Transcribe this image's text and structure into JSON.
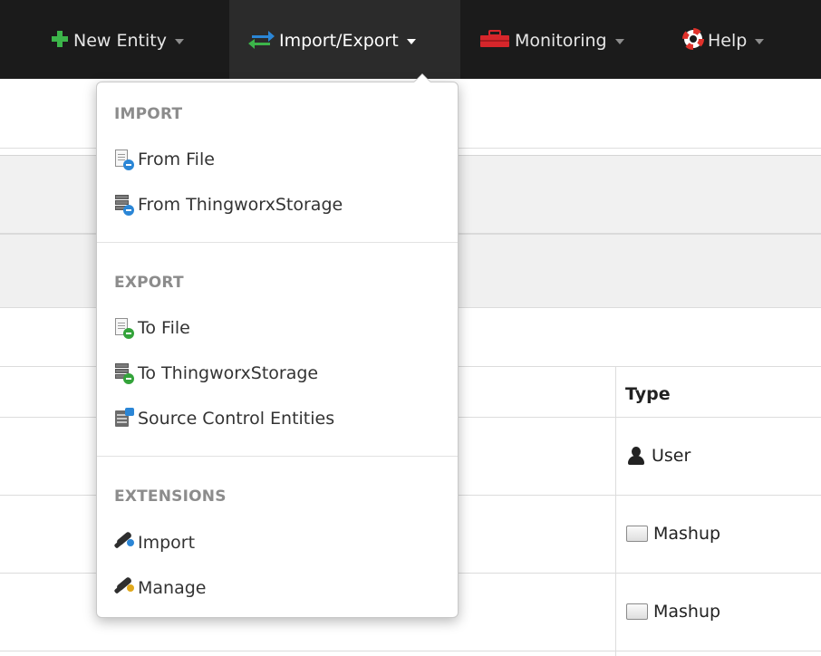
{
  "nav": {
    "items": [
      {
        "label": "New Entity",
        "icon": "plus-icon",
        "active": false
      },
      {
        "label": "Import/Export",
        "icon": "import-export-arrows-icon",
        "active": true
      },
      {
        "label": "Monitoring",
        "icon": "toolbox-icon",
        "active": false
      },
      {
        "label": "Help",
        "icon": "lifebuoy-icon",
        "active": false
      }
    ]
  },
  "dropdown": {
    "sections": [
      {
        "header": "IMPORT",
        "items": [
          {
            "label": "From File",
            "icon": "file-import-icon"
          },
          {
            "label": "From ThingworxStorage",
            "icon": "storage-import-icon"
          }
        ]
      },
      {
        "header": "EXPORT",
        "items": [
          {
            "label": "To File",
            "icon": "file-export-icon"
          },
          {
            "label": "To ThingworxStorage",
            "icon": "storage-export-icon"
          },
          {
            "label": "Source Control Entities",
            "icon": "source-control-icon"
          }
        ]
      },
      {
        "header": "EXTENSIONS",
        "items": [
          {
            "label": "Import",
            "icon": "plug-import-icon"
          },
          {
            "label": "Manage",
            "icon": "plug-manage-icon"
          }
        ]
      }
    ]
  },
  "table": {
    "type_header": "Type",
    "rows": [
      {
        "type": "User",
        "icon": "user-icon"
      },
      {
        "type": "Mashup",
        "icon": "mashup-icon"
      },
      {
        "type": "Mashup",
        "icon": "mashup-icon"
      }
    ]
  },
  "colors": {
    "navbar": "#1b1b1b",
    "navbar_active": "#2b2b2b",
    "plus_green": "#3cb54a",
    "import_blue": "#2b86d6",
    "export_green": "#33a33a",
    "toolbox_red": "#d6262b",
    "lifebuoy_red": "#e0322b"
  }
}
